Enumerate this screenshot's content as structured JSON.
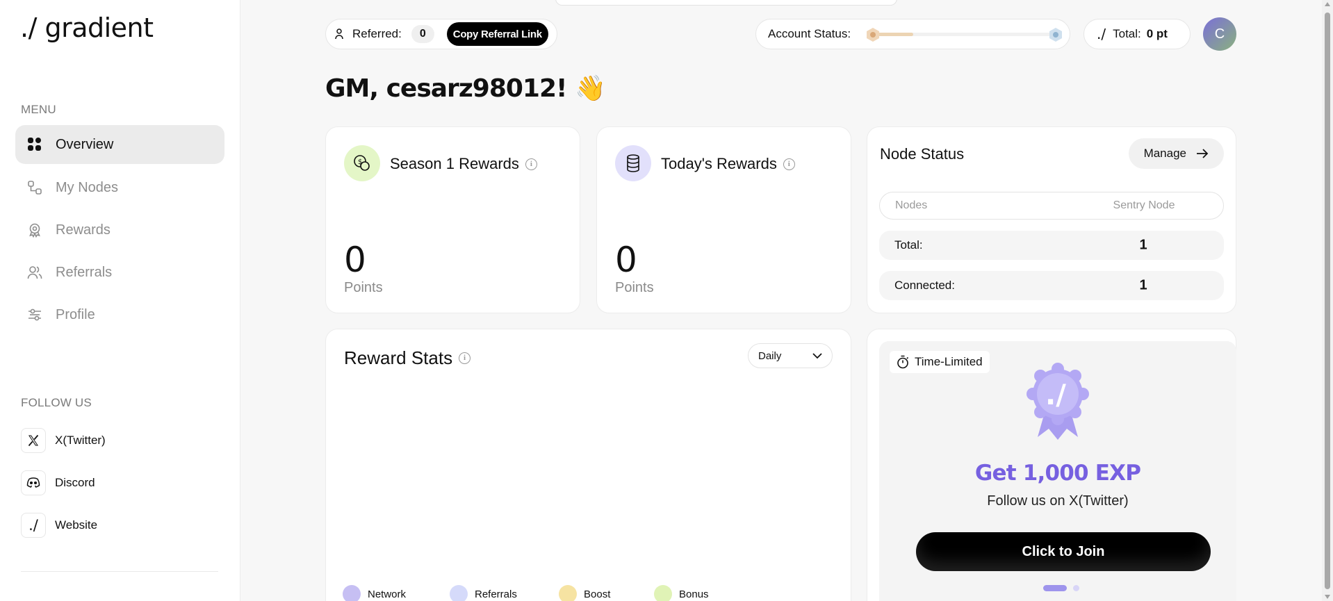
{
  "sidebar": {
    "logo": "./ gradient",
    "menu_label": "MENU",
    "nav": [
      {
        "label": "Overview",
        "icon": "grid-icon",
        "active": true
      },
      {
        "label": "My Nodes",
        "icon": "nodes-icon",
        "active": false
      },
      {
        "label": "Rewards",
        "icon": "award-icon",
        "active": false
      },
      {
        "label": "Referrals",
        "icon": "users-icon",
        "active": false
      },
      {
        "label": "Profile",
        "icon": "sliders-icon",
        "active": false
      }
    ],
    "follow_label": "FOLLOW US",
    "follow": [
      {
        "label": "X(Twitter)",
        "icon": "x-logo-icon"
      },
      {
        "label": "Discord",
        "icon": "discord-icon"
      },
      {
        "label": "Website",
        "icon": "gradient-logo-icon"
      }
    ]
  },
  "topbar": {
    "referred_label": "Referred:",
    "referred_count": "0",
    "copy_button": "Copy Referral Link",
    "account_status_label": "Account Status:",
    "account_status_progress": 0.23,
    "total_label": "Total:",
    "total_value": "0 pt",
    "avatar_initial": "C"
  },
  "greeting": "GM, cesarz98012! 👋",
  "season_rewards": {
    "title": "Season 1 Rewards",
    "value": "0",
    "unit": "Points"
  },
  "today_rewards": {
    "title": "Today's Rewards",
    "value": "0",
    "unit": "Points"
  },
  "node_status": {
    "title": "Node Status",
    "manage_button": "Manage",
    "header": {
      "col1": "Nodes",
      "col2": "Sentry Node"
    },
    "rows": [
      {
        "label": "Total:",
        "value": "1"
      },
      {
        "label": "Connected:",
        "value": "1"
      }
    ]
  },
  "reward_stats": {
    "title": "Reward Stats",
    "period": "Daily",
    "legend": [
      {
        "label": "Network",
        "color": "#c6bff3"
      },
      {
        "label": "Referrals",
        "color": "#d5dafa"
      },
      {
        "label": "Boost",
        "color": "#f6e3a2"
      },
      {
        "label": "Bonus",
        "color": "#e0f3b6"
      }
    ]
  },
  "promo": {
    "badge": "Time-Limited",
    "headline": "Get 1,000 EXP",
    "subtitle": "Follow us on X(Twitter)",
    "button": "Click to Join",
    "accent_color": "#7660e0"
  }
}
